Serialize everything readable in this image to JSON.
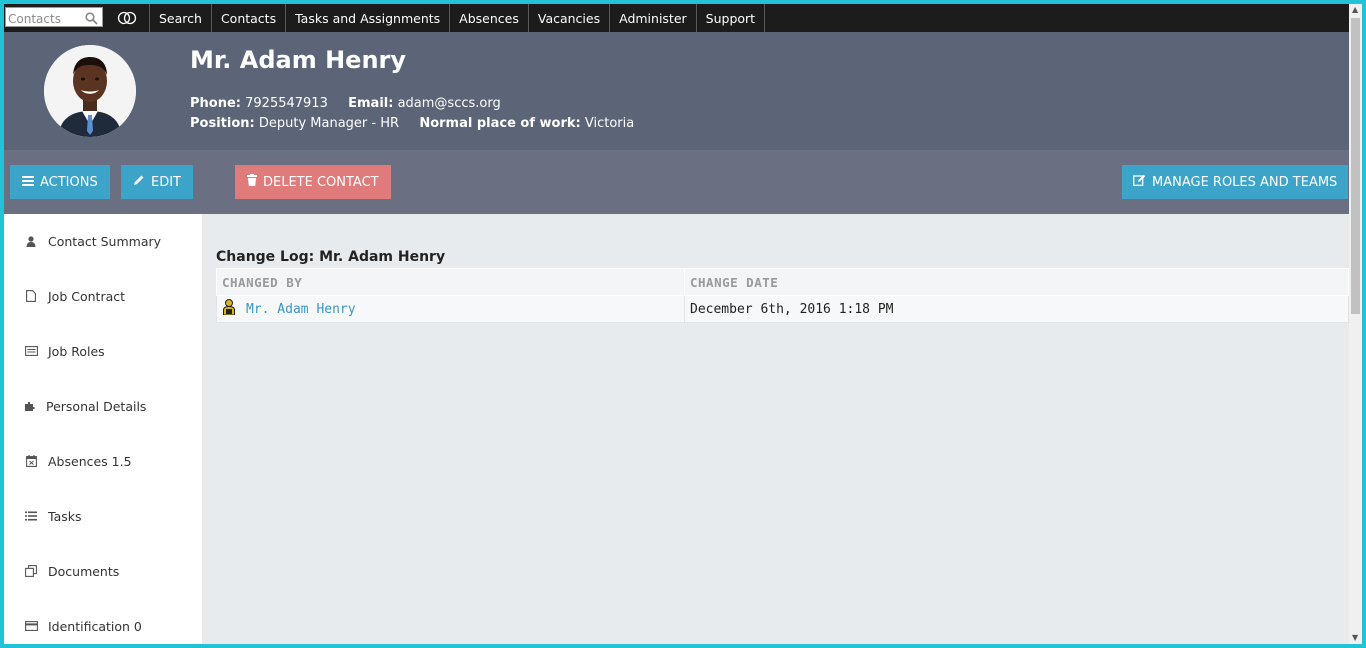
{
  "search": {
    "placeholder": "Contacts"
  },
  "nav": {
    "items": [
      "Search",
      "Contacts",
      "Tasks and Assignments",
      "Absences",
      "Vacancies",
      "Administer",
      "Support"
    ]
  },
  "profile": {
    "name": "Mr. Adam Henry",
    "phone_label": "Phone:",
    "phone": "7925547913",
    "email_label": "Email:",
    "email": "adam@sccs.org",
    "position_label": "Position:",
    "position": "Deputy Manager - HR",
    "workplace_label": "Normal place of work:",
    "workplace": "Victoria"
  },
  "actions": {
    "actions_label": "Actions",
    "edit_label": "Edit",
    "delete_label": "Delete Contact",
    "manage_label": "Manage Roles and Teams"
  },
  "sidebar": {
    "items": [
      {
        "label": "Contact Summary",
        "icon": "person-icon"
      },
      {
        "label": "Job Contract",
        "icon": "document-icon"
      },
      {
        "label": "Job Roles",
        "icon": "list-card-icon"
      },
      {
        "label": "Personal Details",
        "icon": "puzzle-icon"
      },
      {
        "label": "Absences 1.5",
        "icon": "calendar-icon"
      },
      {
        "label": "Tasks",
        "icon": "list-icon"
      },
      {
        "label": "Documents",
        "icon": "documents-icon"
      },
      {
        "label": "Identification 0",
        "icon": "id-card-icon"
      }
    ]
  },
  "changelog": {
    "title": "Change Log: Mr. Adam Henry",
    "columns": [
      "CHANGED BY",
      "CHANGE DATE"
    ],
    "rows": [
      {
        "changed_by": "Mr. Adam Henry",
        "change_date": "December 6th, 2016 1:18 PM"
      }
    ]
  },
  "colors": {
    "accent_blue": "#3ba4c8",
    "danger_red": "#e07b7b",
    "header_bg": "#5c6478",
    "frame_border": "#22c3d6"
  }
}
